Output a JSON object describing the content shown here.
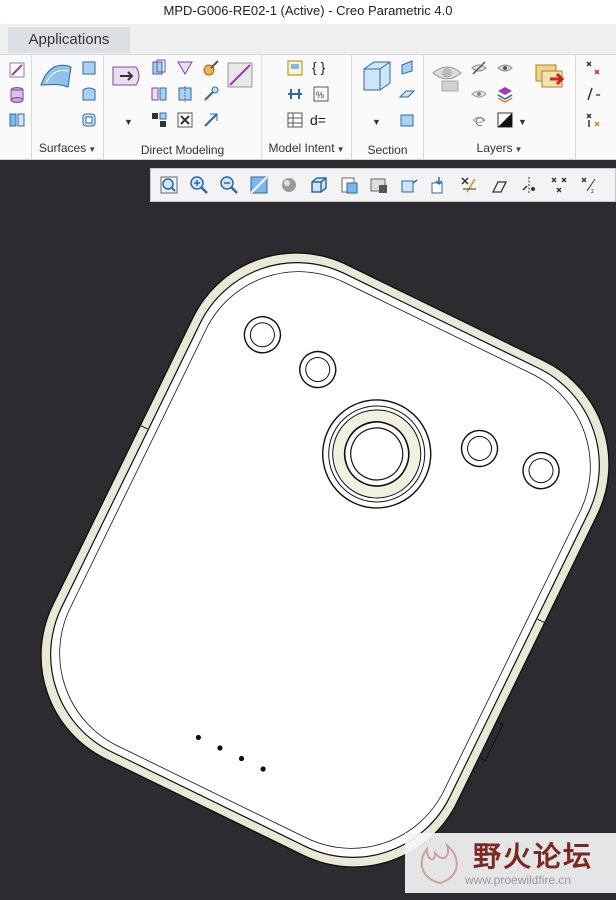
{
  "window": {
    "title": "MPD-G006-RE02-1 (Active) - Creo Parametric 4.0"
  },
  "tabs": {
    "applications_label": "Applications"
  },
  "ribbon": {
    "groups": [
      {
        "label": "Surfaces",
        "has_menu": true
      },
      {
        "label": "Direct Modeling",
        "has_menu": false
      },
      {
        "label": "Model Intent",
        "has_menu": true
      },
      {
        "label": "Section",
        "has_menu": false
      },
      {
        "label": "Layers",
        "has_menu": true
      }
    ],
    "model_intent_icons": [
      "{ }",
      "d="
    ]
  },
  "view_toolbar": {
    "icons": [
      "refit-icon",
      "zoom-in-icon",
      "zoom-out-icon",
      "repaint-icon",
      "display-style-icon",
      "saved-orientations-icon",
      "named-views-icon",
      "view-manager-icon",
      "perspective-icon",
      "annotation-display-icon",
      "datum-plane-display-icon",
      "datum-axis-display-icon",
      "point-display-icon",
      "csys-display-icon",
      "spin-center-icon"
    ]
  },
  "model": {
    "name": "phone-back-cover",
    "colors": {
      "body": "#ffffff",
      "outline": "#000000",
      "rim": "#e9e9d8",
      "background": "#2b2b30"
    },
    "small_holes": 4,
    "speaker_dots": 4
  },
  "watermark": {
    "title": "野火论坛",
    "url": "www.proewildfire.cn"
  }
}
